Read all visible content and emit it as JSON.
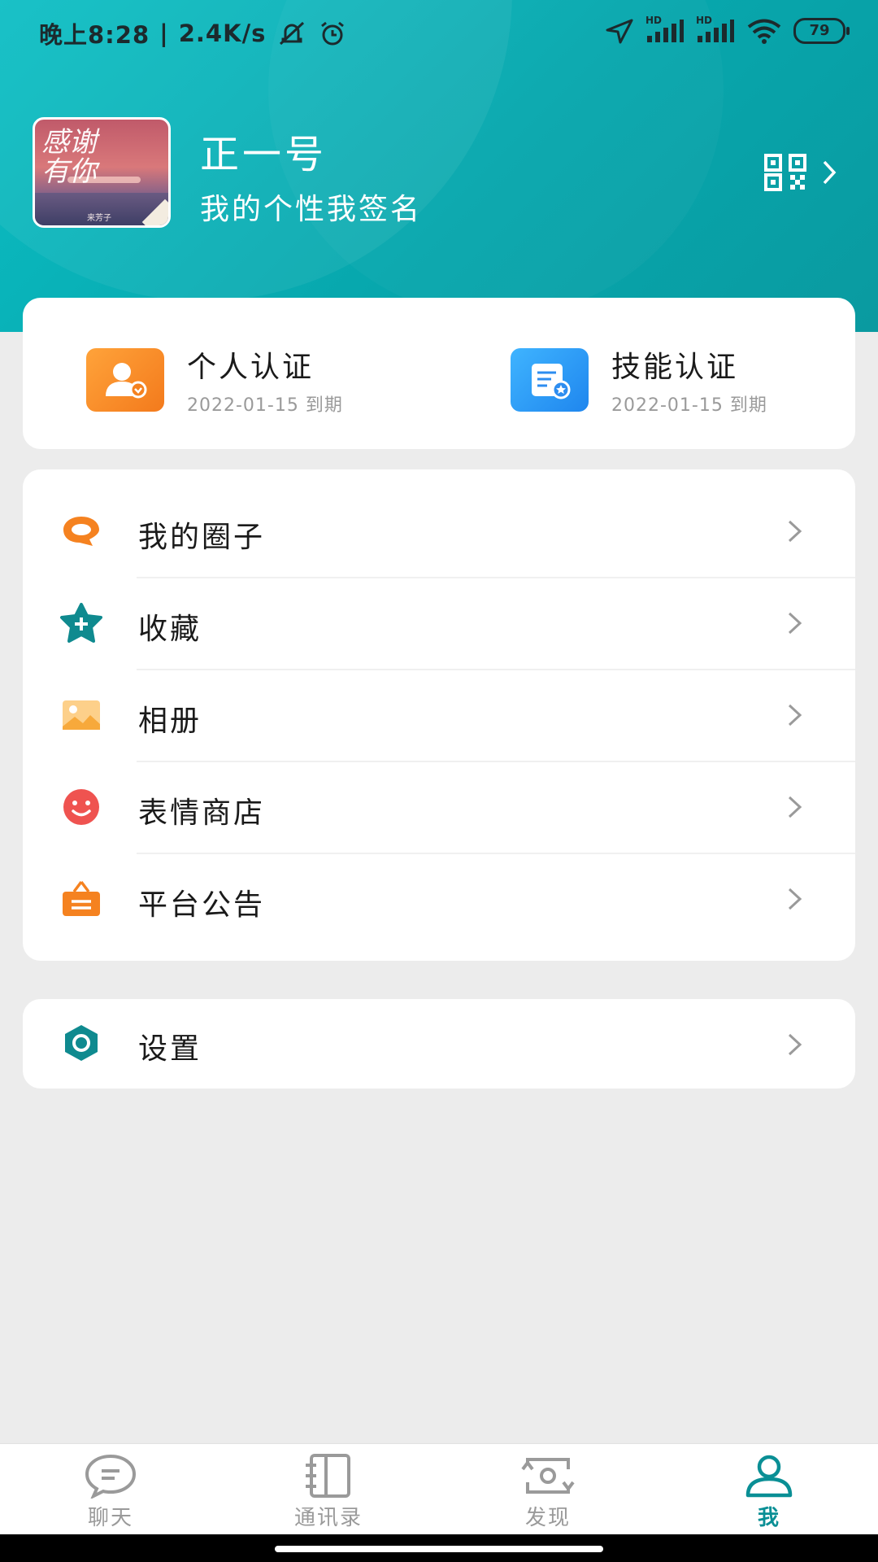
{
  "status_bar": {
    "time": "晚上8:28",
    "net_speed": "2.4K/s",
    "battery": "79",
    "signal_label_1": "HD",
    "signal_label_2": "HD"
  },
  "profile": {
    "name": "正一号",
    "signature": "我的个性我签名",
    "avatar_text": "感谢有你",
    "avatar_small": "来芳子"
  },
  "certifications": [
    {
      "title": "个人认证",
      "expiry": "2022-01-15 到期"
    },
    {
      "title": "技能认证",
      "expiry": "2022-01-15 到期"
    }
  ],
  "menu": [
    {
      "label": "我的圈子",
      "icon": "circle-chat-icon"
    },
    {
      "label": "收藏",
      "icon": "star-plus-icon"
    },
    {
      "label": "相册",
      "icon": "image-icon"
    },
    {
      "label": "表情商店",
      "icon": "smiley-icon"
    },
    {
      "label": "平台公告",
      "icon": "notice-board-icon"
    }
  ],
  "settings": {
    "label": "设置",
    "icon": "hexagon-settings-icon"
  },
  "bottom_nav": [
    {
      "label": "聊天",
      "icon": "chat-bubble-icon",
      "active": false
    },
    {
      "label": "通讯录",
      "icon": "contacts-book-icon",
      "active": false
    },
    {
      "label": "发现",
      "icon": "discover-icon",
      "active": false
    },
    {
      "label": "我",
      "icon": "person-icon",
      "active": true
    }
  ],
  "colors": {
    "accent": "#0a8f95",
    "header": "#07a7ad",
    "orange": "#f58220",
    "teal_icon": "#0f8a8f",
    "blue_icon": "#2d8df0"
  }
}
